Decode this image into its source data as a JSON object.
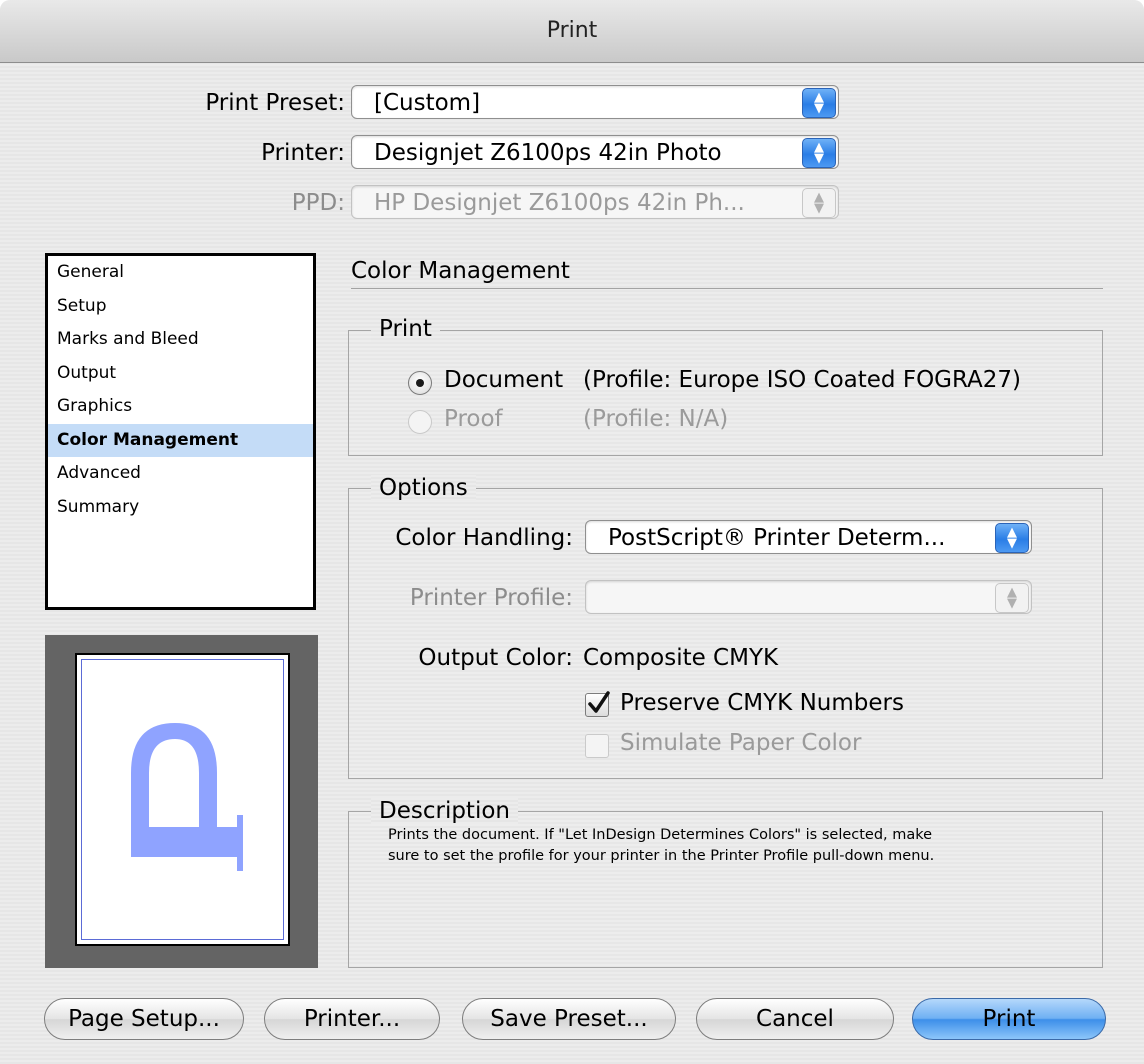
{
  "window": {
    "title": "Print"
  },
  "print_preset": {
    "label": "Print Preset:",
    "value": "[Custom]"
  },
  "printer": {
    "label": "Printer:",
    "value": "Designjet Z6100ps 42in Photo"
  },
  "ppd": {
    "label": "PPD:",
    "value": "HP Designjet Z6100ps 42in Ph..."
  },
  "sidebar": {
    "items": [
      {
        "label": "General"
      },
      {
        "label": "Setup"
      },
      {
        "label": "Marks and Bleed"
      },
      {
        "label": "Output"
      },
      {
        "label": "Graphics"
      },
      {
        "label": "Color Management",
        "selected": true
      },
      {
        "label": "Advanced"
      },
      {
        "label": "Summary"
      }
    ]
  },
  "preview": {
    "glyph": "P",
    "glyph_color": "#8fa3ff"
  },
  "panel": {
    "title": "Color Management"
  },
  "print_group": {
    "title": "Print",
    "document": {
      "label": "Document",
      "profile": "(Profile: Europe ISO Coated FOGRA27)",
      "selected": true
    },
    "proof": {
      "label": "Proof",
      "profile": "(Profile: N/A)",
      "enabled": false
    }
  },
  "options_group": {
    "title": "Options",
    "color_handling": {
      "label": "Color Handling:",
      "value": "PostScript® Printer Determ..."
    },
    "printer_profile": {
      "label": "Printer Profile:",
      "value": ""
    },
    "output_color": {
      "label": "Output Color:",
      "value": "Composite CMYK"
    },
    "preserve_cmyk": {
      "label": "Preserve CMYK Numbers",
      "checked": true
    },
    "simulate_paper": {
      "label": "Simulate Paper Color",
      "checked": false,
      "enabled": false
    }
  },
  "description_group": {
    "title": "Description",
    "line1": "Prints the document. If \"Let InDesign Determines Colors\" is selected, make",
    "line2": "sure to set the profile for your printer in the Printer Profile pull-down menu."
  },
  "buttons": {
    "page_setup": "Page Setup...",
    "printer": "Printer...",
    "save_preset": "Save Preset...",
    "cancel": "Cancel",
    "print": "Print"
  },
  "colors": {
    "accent": "#3d8fe9",
    "selection": "#c4dcf7"
  }
}
